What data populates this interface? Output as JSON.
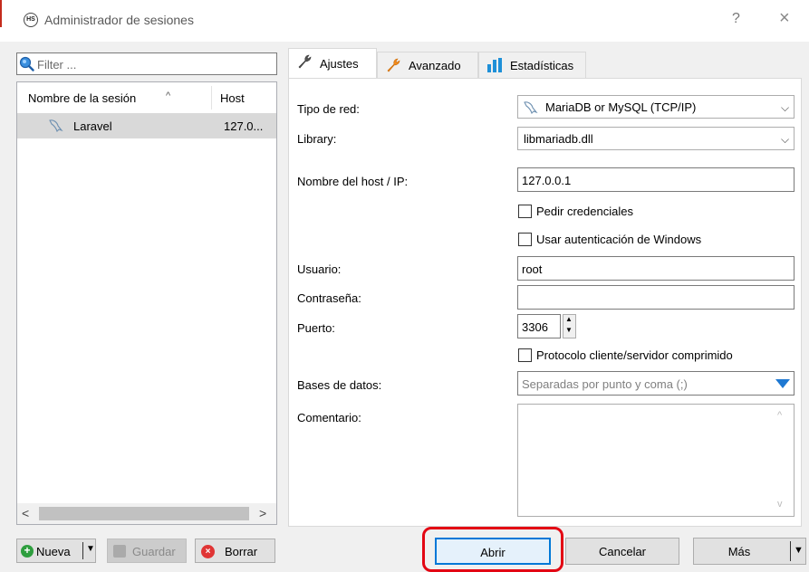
{
  "window": {
    "title": "Administrador de sesiones",
    "app_icon_text": "HS",
    "help_symbol": "?",
    "close_symbol": "×"
  },
  "filter": {
    "placeholder": "Filter ..."
  },
  "session_list": {
    "columns": [
      "Nombre de la sesión",
      "Host"
    ],
    "sort_indicator": "^",
    "rows": [
      {
        "name": "Laravel",
        "host": "127.0...",
        "icon": "dolphin-icon",
        "selected": true
      }
    ],
    "scroll_left": "<",
    "scroll_right": ">"
  },
  "left_buttons": {
    "new": "Nueva",
    "new_icon": "+",
    "save": "Guardar",
    "delete": "Borrar",
    "delete_icon": "×"
  },
  "tabs": [
    {
      "label": "Ajustes",
      "icon": "wrench-icon",
      "active": true
    },
    {
      "label": "Avanzado",
      "icon": "wrench-orange-icon",
      "active": false
    },
    {
      "label": "Estadísticas",
      "icon": "bar-chart-icon",
      "active": false
    }
  ],
  "settings": {
    "network_type_label": "Tipo de red:",
    "network_type_value": "MariaDB or MySQL (TCP/IP)",
    "library_label": "Library:",
    "library_value": "libmariadb.dll",
    "host_label": "Nombre del host / IP:",
    "host_value": "127.0.0.1",
    "ask_credentials_label": "Pedir credenciales",
    "ask_credentials_checked": false,
    "windows_auth_label": "Usar autenticación de Windows",
    "windows_auth_checked": false,
    "user_label": "Usuario:",
    "user_value": "root",
    "password_label": "Contraseña:",
    "password_value": "",
    "port_label": "Puerto:",
    "port_value": "3306",
    "compressed_label": "Protocolo cliente/servidor comprimido",
    "compressed_checked": false,
    "databases_label": "Bases de datos:",
    "databases_placeholder": "Separadas por punto y coma (;)",
    "comment_label": "Comentario:",
    "comment_value": ""
  },
  "right_buttons": {
    "open": "Abrir",
    "cancel": "Cancelar",
    "more": "Más"
  },
  "colors": {
    "accent": "#0078d7",
    "highlight": "#e30613",
    "dialog_bg": "#f0f0f0"
  }
}
